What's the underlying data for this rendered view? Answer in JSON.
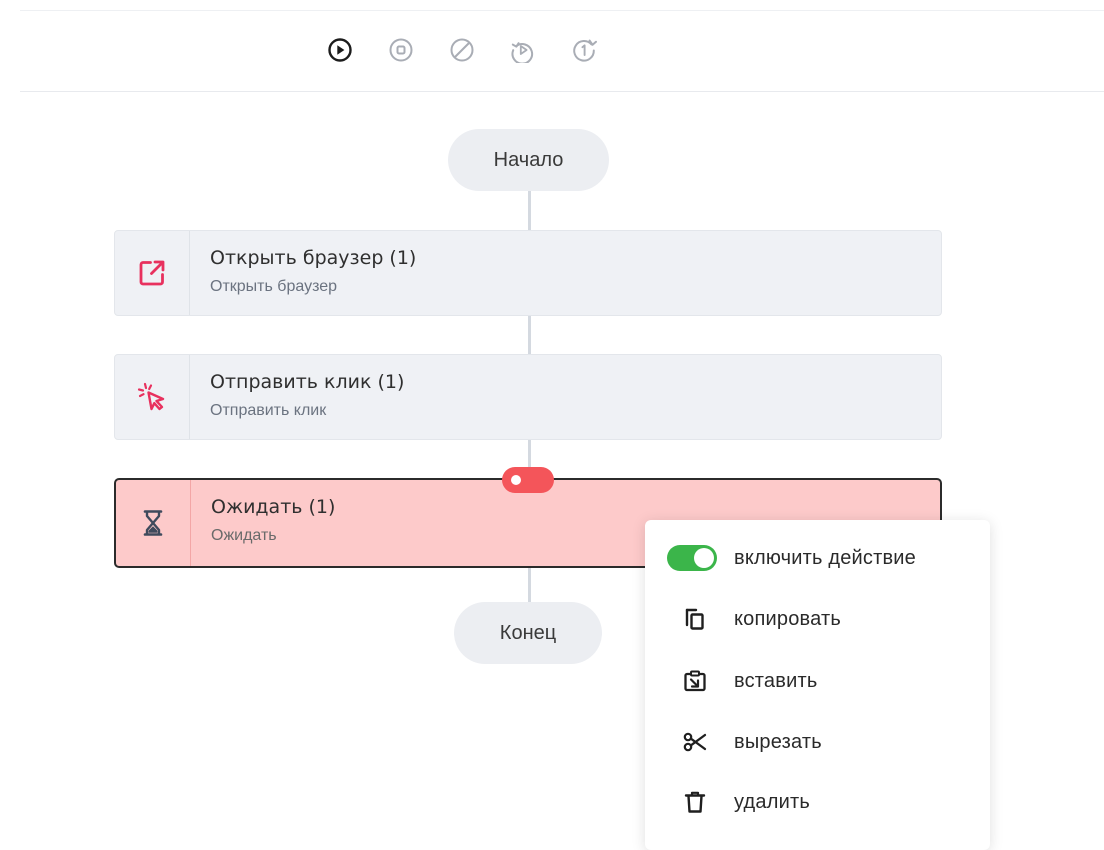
{
  "colors": {
    "accent_pink": "#e8315e",
    "active_node_bg": "#fdcaca",
    "toggle_green": "#3bb54a",
    "badge_red": "#f4555a"
  },
  "toolbar": {
    "buttons": [
      {
        "icon": "play-circle-icon",
        "enabled": true
      },
      {
        "icon": "stop-circle-icon",
        "enabled": false
      },
      {
        "icon": "disable-circle-icon",
        "enabled": false
      },
      {
        "icon": "replay-circle-icon",
        "enabled": false
      },
      {
        "icon": "repeat-one-icon",
        "enabled": false
      }
    ]
  },
  "flow": {
    "start_label": "Начало",
    "end_label": "Конец",
    "nodes": [
      {
        "icon": "open-external-icon",
        "title": "Открыть браузер (1)",
        "subtitle": "Открыть браузер",
        "active": false
      },
      {
        "icon": "click-cursor-icon",
        "title": "Отправить клик (1)",
        "subtitle": "Отправить клик",
        "active": false
      },
      {
        "icon": "hourglass-icon",
        "title": "Ожидать (1)",
        "subtitle": "Ожидать",
        "active": true
      }
    ]
  },
  "context_menu": {
    "items": [
      {
        "label": "включить действие",
        "icon": "toggle-switch-icon",
        "checked": true
      },
      {
        "label": "копировать",
        "icon": "copy-icon"
      },
      {
        "label": "вставить",
        "icon": "paste-icon"
      },
      {
        "label": "вырезать",
        "icon": "scissors-icon"
      },
      {
        "label": "удалить",
        "icon": "trash-icon"
      }
    ]
  }
}
